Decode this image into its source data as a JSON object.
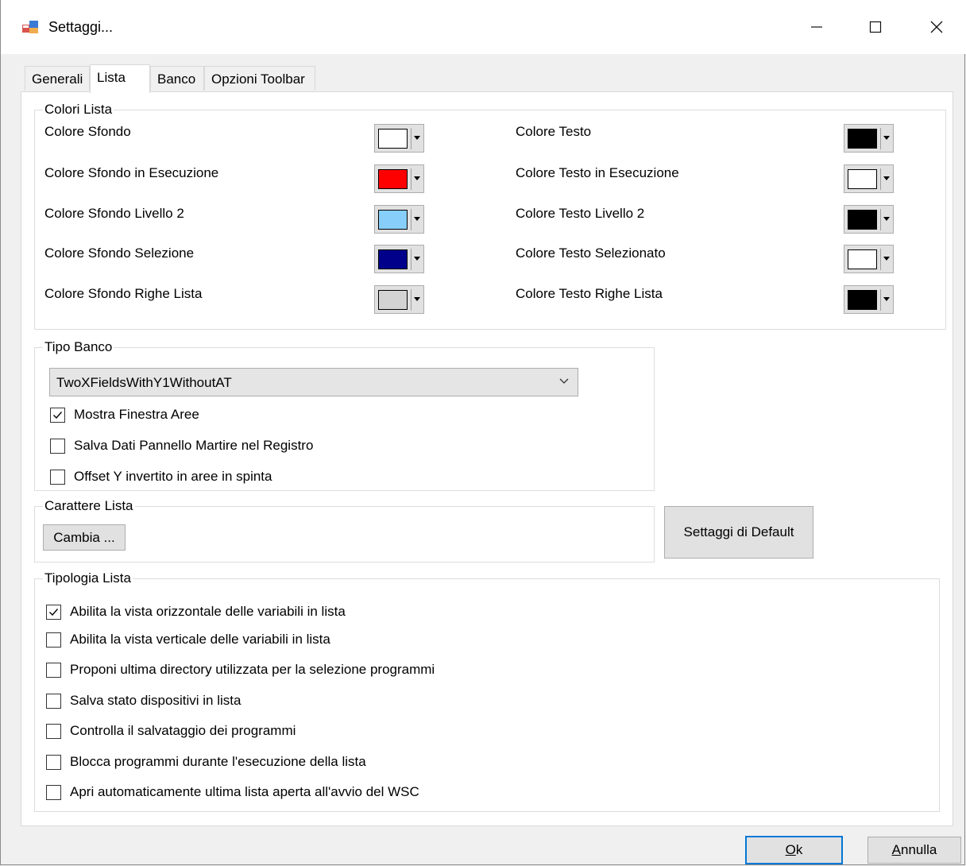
{
  "window": {
    "title": "Settaggi..."
  },
  "tabs": [
    {
      "label": "Generali"
    },
    {
      "label": "Lista"
    },
    {
      "label": "Banco"
    },
    {
      "label": "Opzioni Toolbar"
    }
  ],
  "colori_lista": {
    "title": "Colori Lista",
    "left": [
      {
        "label": "Colore Sfondo",
        "color": "#ffffff"
      },
      {
        "label": "Colore Sfondo in Esecuzione",
        "color": "#ff0000"
      },
      {
        "label": "Colore Sfondo Livello 2",
        "color": "#87cefa"
      },
      {
        "label": "Colore Sfondo Selezione",
        "color": "#00008b"
      },
      {
        "label": "Colore Sfondo Righe Lista",
        "color": "#d3d3d3"
      }
    ],
    "right": [
      {
        "label": "Colore Testo",
        "color": "#000000"
      },
      {
        "label": "Colore Testo in Esecuzione",
        "color": "#ffffff"
      },
      {
        "label": "Colore Testo Livello 2",
        "color": "#000000"
      },
      {
        "label": "Colore Testo Selezionato",
        "color": "#ffffff"
      },
      {
        "label": "Colore Testo Righe Lista",
        "color": "#000000"
      }
    ]
  },
  "tipo_banco": {
    "title": "Tipo Banco",
    "selected": "TwoXFieldsWithY1WithoutAT",
    "checks": [
      {
        "label": "Mostra Finestra Aree",
        "checked": true
      },
      {
        "label": "Salva Dati Pannello Martire nel Registro",
        "checked": false
      },
      {
        "label": "Offset Y invertito in aree in spinta",
        "checked": false
      }
    ]
  },
  "carattere_lista": {
    "title": "Carattere Lista",
    "button": "Cambia ..."
  },
  "default_button": "Settaggi di Default",
  "tipologia_lista": {
    "title": "Tipologia Lista",
    "checks": [
      {
        "label": "Abilita la vista orizzontale delle variabili in lista",
        "checked": true
      },
      {
        "label": "Abilita la vista verticale delle variabili in lista",
        "checked": false
      },
      {
        "label": "Proponi ultima directory utilizzata per la selezione programmi",
        "checked": false
      },
      {
        "label": "Salva stato dispositivi in lista",
        "checked": false
      },
      {
        "label": "Controlla il salvataggio dei programmi",
        "checked": false
      },
      {
        "label": "Blocca programmi durante l'esecuzione della lista",
        "checked": false
      },
      {
        "label": "Apri automaticamente ultima lista aperta all'avvio del WSC",
        "checked": false
      }
    ]
  },
  "footer": {
    "ok_mnemonic": "O",
    "ok_rest": "k",
    "cancel_mnemonic": "A",
    "cancel_rest": "nnulla"
  },
  "icons": [
    "app-icon",
    "minimize-icon",
    "maximize-icon",
    "close-icon",
    "dropdown-arrow-icon",
    "checkmark-icon"
  ]
}
